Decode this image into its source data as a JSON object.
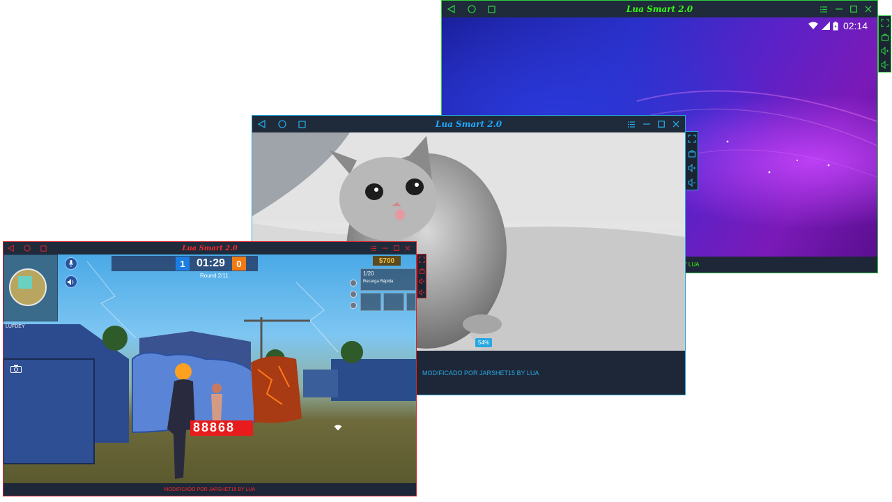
{
  "windows": [
    {
      "id": "green",
      "title": "Lua Smart 2.0",
      "accent": "#2ecc40",
      "status_time": "02:14",
      "footer": "MODIFICADO POR JARSHET15 BY LUA",
      "footer_visible": "15 BY LUA"
    },
    {
      "id": "blue",
      "title": "Lua Smart 2.0",
      "accent": "#27a8e0",
      "footer": "MODIFICADO POR JARSHET15 BY LUA",
      "badge": "54%"
    },
    {
      "id": "red",
      "title": "Lua Smart 2.0",
      "accent": "#d4262e",
      "footer": "MODIFICADO POR JARSHET15 BY LUA",
      "hud": {
        "team_a_score": "1",
        "timer": "01:29",
        "team_b_score": "0",
        "round": "Round 2/11",
        "money": "$700",
        "ammo": "1/20",
        "weapon": "Recarga Rápida",
        "minimap_label": "LUFDEY",
        "damage": "88868"
      }
    }
  ],
  "icons": {
    "nav": [
      "back-icon",
      "home-icon",
      "recent-apps-icon"
    ],
    "window_controls": [
      "menu-list-icon",
      "minimize-icon",
      "maximize-icon",
      "close-icon"
    ],
    "sidebar": [
      "fullscreen-icon",
      "android-icon",
      "volume-up-icon",
      "volume-down-icon"
    ]
  }
}
